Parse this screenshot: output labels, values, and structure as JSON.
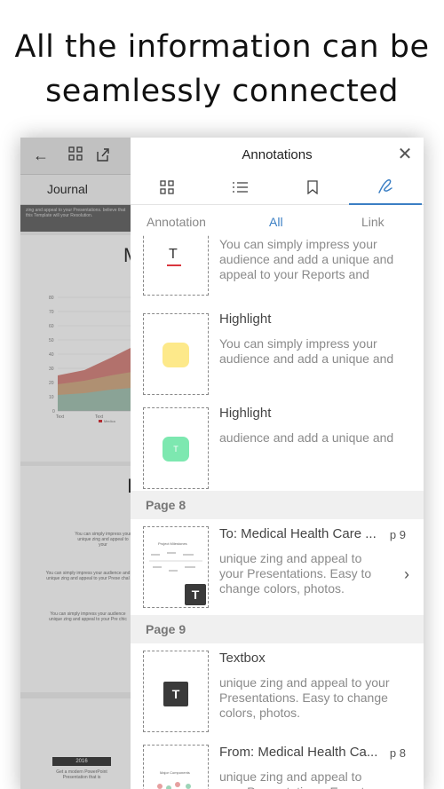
{
  "headline": {
    "line1": "All the information can be",
    "line2": "seamlessly connected"
  },
  "doc": {
    "tab_label": "Journal",
    "banner_text": "zing and appeal to your Presentations. believe that this Template will your Resolution.",
    "page_letter_1": "M",
    "chart_legend": "Medica",
    "chart_ticks": [
      "80",
      "70",
      "60",
      "50",
      "40",
      "30",
      "20",
      "10",
      "0"
    ],
    "chart_xlabels": [
      "Text",
      "Text"
    ],
    "page_letter_2": "I",
    "small_texts": [
      "You can simply impress your unique zing and appeal to your",
      "You can simply impress your audience and unique zing and appeal to your Prese chal",
      "You can simply impress your audience unique zing and appeal to your Pre chic"
    ],
    "year_label": "2016",
    "year_text": "Get a modern PowerPoint Presentation that is"
  },
  "panel": {
    "title": "Annotations",
    "close_icon": "close-icon",
    "icon_tabs": [
      "grid-icon",
      "list-icon",
      "bookmark-icon",
      "pen-icon"
    ],
    "filter_tabs": {
      "annotation": "Annotation",
      "all": "All",
      "link": "Link"
    },
    "items": [
      {
        "title": "",
        "text": "You can simply impress your audience and add a unique and appeal to your Reports and"
      },
      {
        "title": "Highlight",
        "text": "You can simply impress your audience and add a unique and",
        "color": "#fde98a"
      },
      {
        "title": "Highlight",
        "text": "audience and add a unique and",
        "color": "#7de8b0"
      }
    ],
    "section_8": "Page 8",
    "page8_item": {
      "title": "To: Medical Health Care ...",
      "page": "p 9",
      "text": "unique zing and appeal to your Presentations. Easy to change colors, photos."
    },
    "section_9": "Page 9",
    "page9_item": {
      "title": "Textbox",
      "text": "unique zing and appeal to your Presentations. Easy to  change colors, photos."
    },
    "last_item": {
      "title": "From: Medical Health Ca...",
      "page": "p 8",
      "text": "unique zing and appeal to your Presentations. Easy to"
    },
    "thumb_title_1": "Project Milestones",
    "thumb_title_2": "Major Components",
    "badge_letter": "T"
  },
  "colors": {
    "accent": "#3b7fc4",
    "red_underline": "#d9363e"
  }
}
